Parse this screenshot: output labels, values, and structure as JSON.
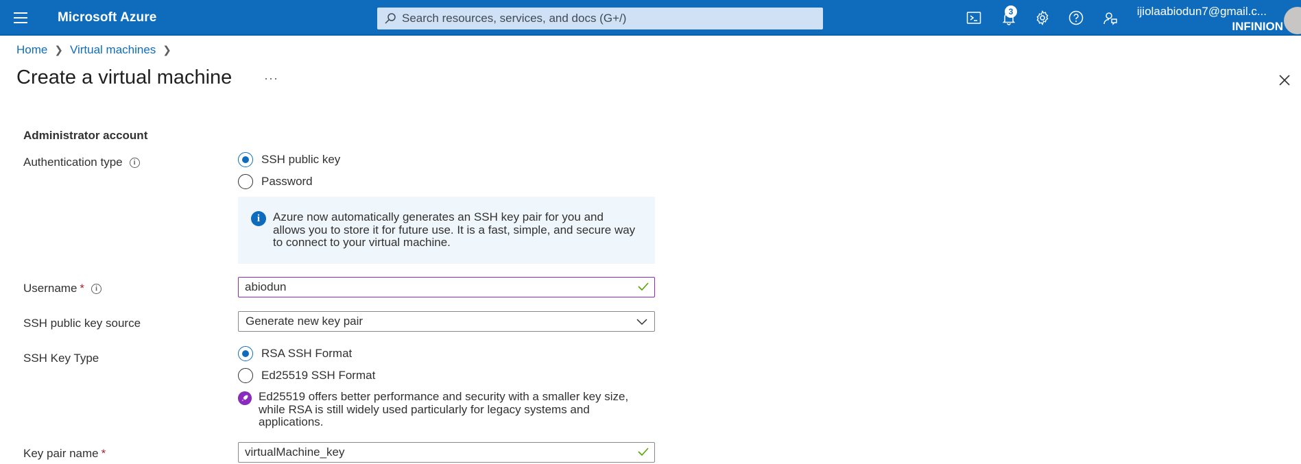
{
  "topbar": {
    "brand": "Microsoft Azure",
    "search_placeholder": "Search resources, services, and docs (G+/)",
    "notification_count": "3",
    "account_email": "ijiolaabiodun7@gmail.c...",
    "account_org": "INFINION",
    "icons": [
      "menu-icon",
      "search-icon",
      "cloud-shell-icon",
      "notifications-icon",
      "settings-icon",
      "help-icon",
      "feedback-icon",
      "avatar"
    ]
  },
  "breadcrumb": [
    {
      "label": "Home"
    },
    {
      "label": "Virtual machines"
    }
  ],
  "page": {
    "title": "Create a virtual machine",
    "more": "···"
  },
  "form": {
    "section_title": "Administrator account",
    "auth_type": {
      "label": "Authentication type",
      "options": [
        "SSH public key",
        "Password"
      ],
      "selected": "SSH public key",
      "info": "Azure now automatically generates an SSH key pair for you and allows you to store it for future use. It is a fast, simple, and secure way to connect to your virtual machine."
    },
    "username": {
      "label": "Username",
      "required": "*",
      "value": "abiodun"
    },
    "ssh_key_source": {
      "label": "SSH public key source",
      "value": "Generate new key pair"
    },
    "ssh_key_type": {
      "label": "SSH Key Type",
      "options": [
        "RSA SSH Format",
        "Ed25519 SSH Format"
      ],
      "selected": "RSA SSH Format",
      "note": "Ed25519 offers better performance and security with a smaller key size, while RSA is still widely used particularly for legacy systems and applications."
    },
    "key_pair_name": {
      "label": "Key pair name",
      "required": "*",
      "value": "virtualMachine_key"
    }
  },
  "colors": {
    "topbar": "#0f6cbd",
    "accent": "#0f6cbd",
    "focus_border": "#8a2bbd",
    "valid_check": "#57a300"
  }
}
